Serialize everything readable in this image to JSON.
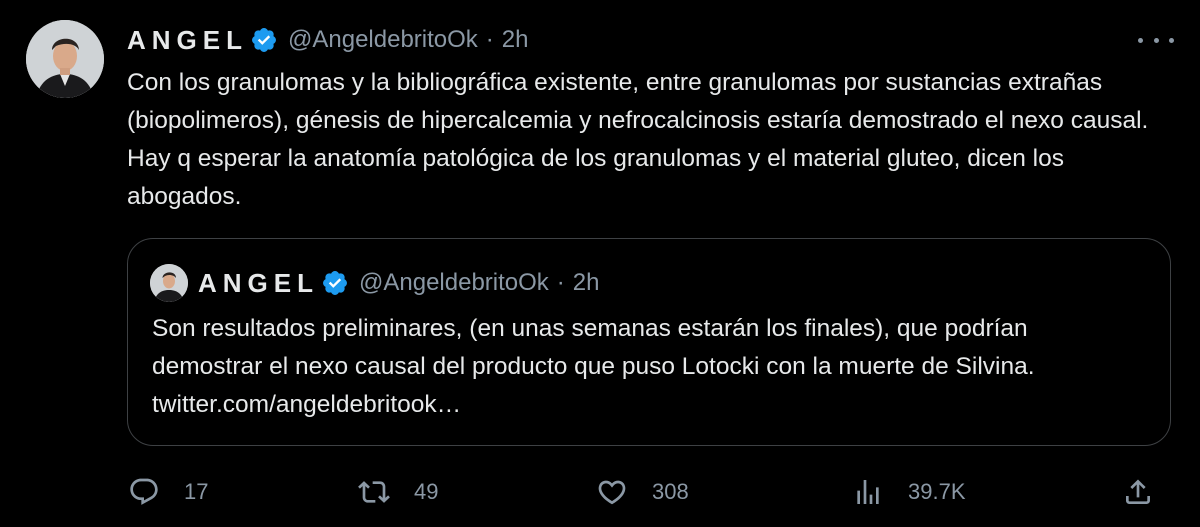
{
  "tweet": {
    "author_name": "ANGEL",
    "handle": "@AngeldebritoOk",
    "separator": "·",
    "time": "2h",
    "body": "Con los granulomas y la bibliográfica existente, entre granulomas por sustancias extrañas (biopolimeros), génesis de hipercalcemia y nefrocalcinosis estaría demostrado el nexo causal. Hay q esperar la anatomía patológica de los granulomas y el material gluteo, dicen los abogados."
  },
  "quoted": {
    "author_name": "ANGEL",
    "handle": "@AngeldebritoOk",
    "separator": "·",
    "time": "2h",
    "body": "Son resultados preliminares, (en unas semanas estarán los finales), que podrían  demostrar el nexo causal del producto que puso Lotocki con la muerte de Silvina. twitter.com/angeldebritook…"
  },
  "actions": {
    "replies": "17",
    "retweets": "49",
    "likes": "308",
    "views": "39.7K"
  },
  "colors": {
    "background": "#000000",
    "text_primary": "#e7e9ea",
    "text_secondary": "#8b98a5",
    "verified_badge": "#1d9bf0",
    "quote_border": "#3e4144"
  },
  "icons": {
    "more": "more-horizontal-icon",
    "verified": "verified-badge-icon",
    "reply": "reply-icon",
    "retweet": "retweet-icon",
    "like": "like-heart-icon",
    "views": "views-chart-icon",
    "share": "share-icon"
  }
}
